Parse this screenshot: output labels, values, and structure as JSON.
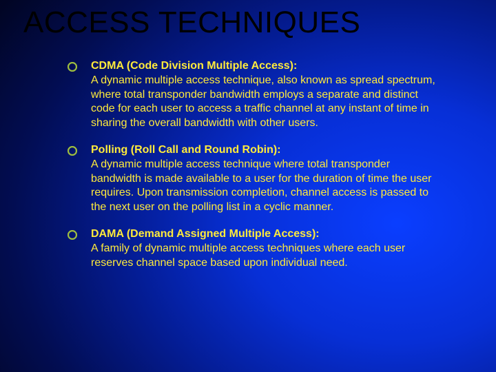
{
  "title": "ACCESS TECHNIQUES",
  "sections": [
    {
      "heading": "CDMA (Code Division Multiple Access):",
      "body": "A dynamic multiple access technique, also known as spread spectrum, where total transponder bandwidth employs a separate and distinct code for each user to access a traffic channel at any instant of time in sharing the overall bandwidth with other users."
    },
    {
      "heading": "Polling (Roll Call and Round Robin):",
      "body": "A dynamic multiple access technique where total transponder bandwidth is made available to a user for the duration of time the user requires. Upon transmission completion, channel access is passed to the next user on the polling list in a cyclic manner."
    },
    {
      "heading": "DAMA (Demand Assigned Multiple Access):",
      "body": "A family of dynamic multiple access techniques where each user reserves channel space based upon individual need."
    }
  ]
}
